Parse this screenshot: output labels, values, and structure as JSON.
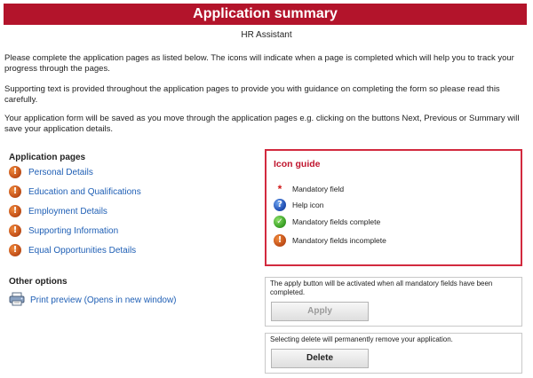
{
  "header": {
    "title": "Application summary",
    "subtitle": "HR Assistant"
  },
  "intro": {
    "p1": "Please complete the application pages as listed below. The icons will indicate when a page is completed which will help you to track your progress through the pages.",
    "p2": "Supporting text is provided throughout the application pages to provide you with guidance on completing the form so please read this carefully.",
    "p3": "Your application form will be saved as you move through the application pages e.g. clicking on the buttons Next, Previous or Summary will save your application details."
  },
  "application_pages": {
    "title": "Application pages",
    "items": [
      {
        "label": "Personal Details",
        "status_icon": "incomplete-icon"
      },
      {
        "label": "Education and Qualifications",
        "status_icon": "incomplete-icon"
      },
      {
        "label": "Employment Details",
        "status_icon": "incomplete-icon"
      },
      {
        "label": "Supporting Information",
        "status_icon": "incomplete-icon"
      },
      {
        "label": "Equal Opportunities Details",
        "status_icon": "incomplete-icon"
      }
    ]
  },
  "other_options": {
    "title": "Other options",
    "print_preview": "Print preview (Opens in new window)"
  },
  "icon_guide": {
    "title": "Icon guide",
    "items": [
      {
        "label": "Mandatory field",
        "icon": "asterisk-icon"
      },
      {
        "label": "Help icon",
        "icon": "help-icon"
      },
      {
        "label": "Mandatory fields complete",
        "icon": "check-icon"
      },
      {
        "label": "Mandatory fields incomplete",
        "icon": "exclamation-icon"
      }
    ]
  },
  "apply_panel": {
    "text": "The apply button will be activated when all mandatory fields have been completed.",
    "button": "Apply"
  },
  "delete_panel": {
    "text": "Selecting delete will permanently remove your application.",
    "button": "Delete"
  },
  "colors": {
    "banner": "#b3142b",
    "link": "#1f5fb5",
    "guide_border": "#d22a3e"
  }
}
